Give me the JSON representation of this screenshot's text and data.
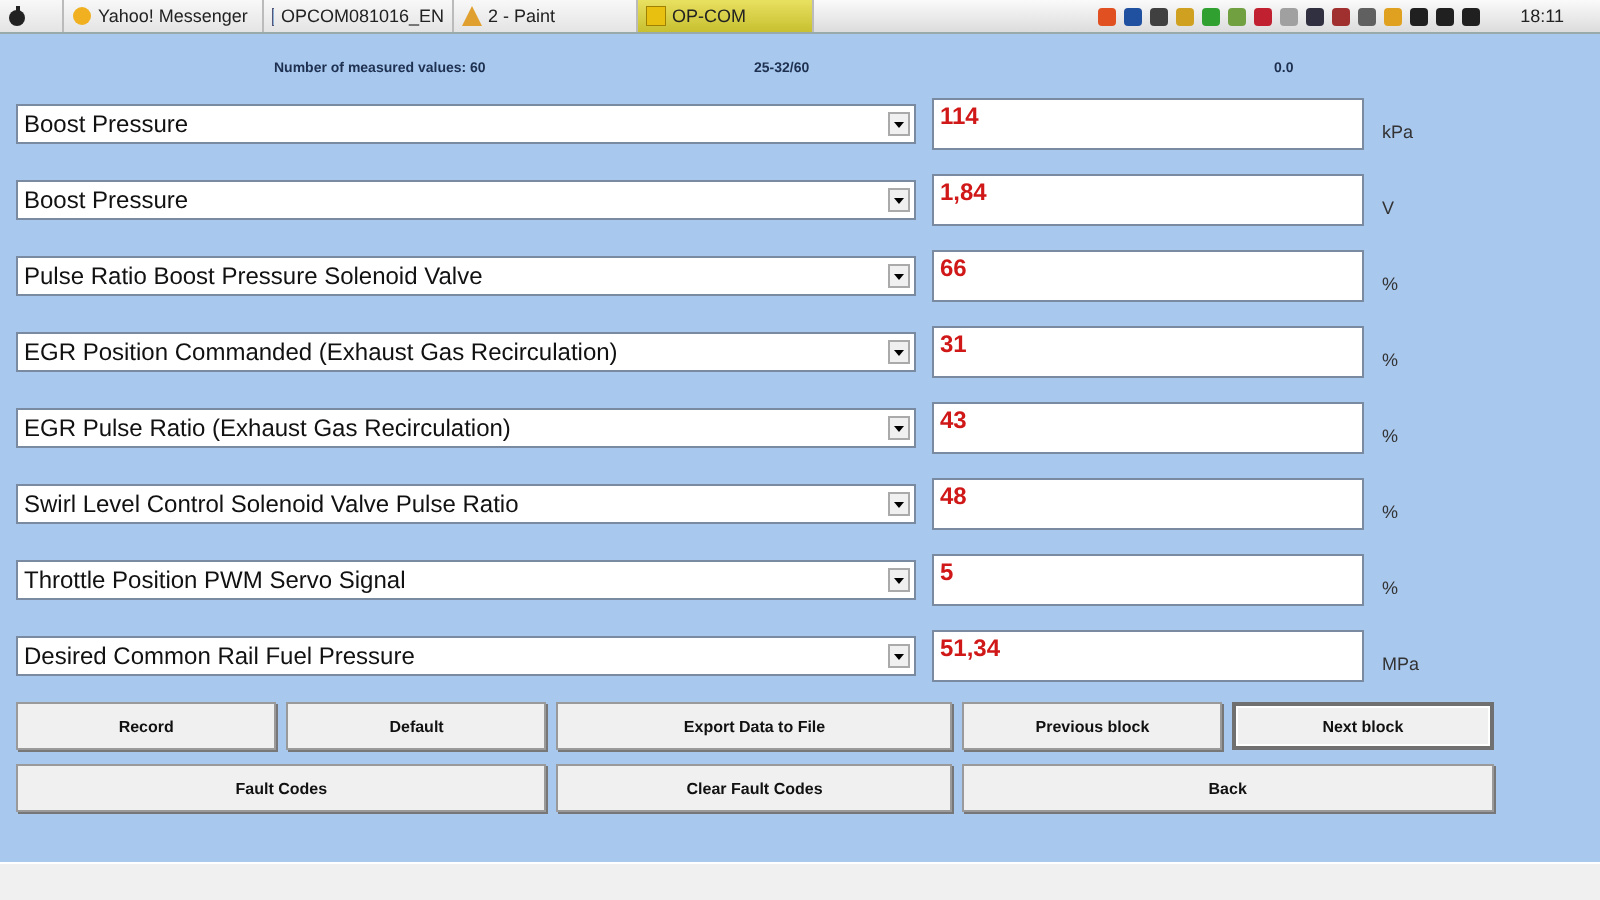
{
  "taskbar": {
    "tasks": [
      {
        "label": "Yahoo! Messenger",
        "kind": "smiley",
        "selected": false
      },
      {
        "label": "OPCOM081016_EN",
        "kind": "folder",
        "selected": false
      },
      {
        "label": "2 - Paint",
        "kind": "paint",
        "selected": false
      },
      {
        "label": "OP-COM",
        "kind": "opcom",
        "selected": true
      }
    ],
    "clock": "18:11"
  },
  "header": {
    "count_label": "Number of measured values: 60",
    "range": "25-32/60",
    "time": "0.0"
  },
  "measurements": [
    {
      "name": "Boost Pressure",
      "value": "114",
      "unit": "kPa"
    },
    {
      "name": "Boost Pressure",
      "value": "1,84",
      "unit": "V"
    },
    {
      "name": "Pulse Ratio Boost Pressure Solenoid Valve",
      "value": "66",
      "unit": "%"
    },
    {
      "name": "EGR Position Commanded (Exhaust Gas Recirculation)",
      "value": "31",
      "unit": "%"
    },
    {
      "name": "EGR Pulse Ratio (Exhaust Gas Recirculation)",
      "value": "43",
      "unit": "%"
    },
    {
      "name": "Swirl Level Control Solenoid Valve Pulse Ratio",
      "value": "48",
      "unit": "%"
    },
    {
      "name": "Throttle Position PWM Servo Signal",
      "value": "5",
      "unit": "%"
    },
    {
      "name": "Desired Common Rail Fuel Pressure",
      "value": "51,34",
      "unit": "MPa"
    }
  ],
  "buttons": [
    [
      {
        "label": "Record",
        "focused": false
      },
      {
        "label": "Default",
        "focused": false
      },
      {
        "label": "Export Data to File",
        "focused": false
      },
      {
        "label": "Previous block",
        "focused": false
      },
      {
        "label": "Next block",
        "focused": true
      }
    ],
    [
      {
        "label": "Fault Codes",
        "focused": false
      },
      {
        "label": "Clear Fault Codes",
        "focused": false
      },
      {
        "label": "Back",
        "focused": false
      }
    ]
  ]
}
